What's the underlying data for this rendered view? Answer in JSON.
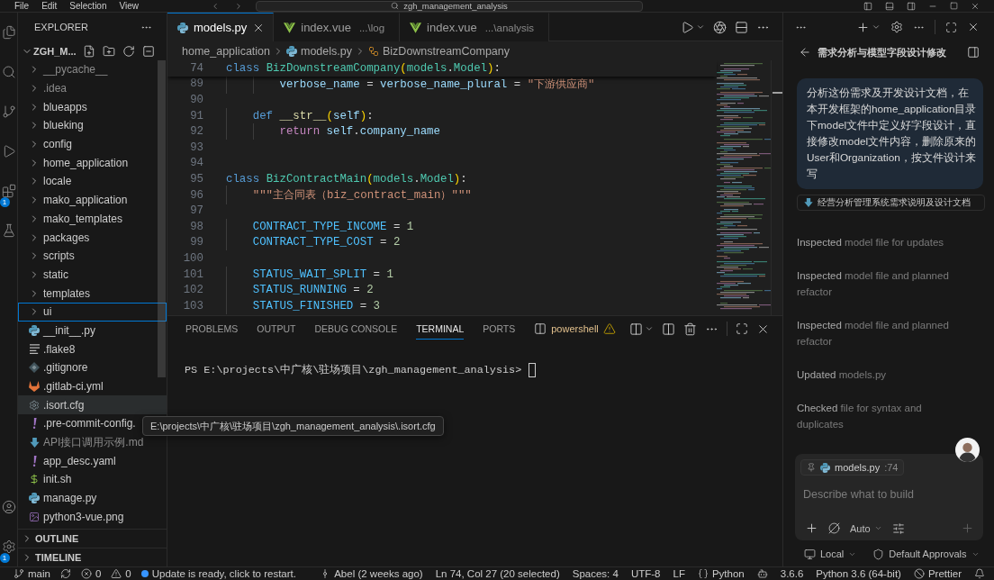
{
  "title_bar": {
    "menu": [
      "File",
      "Edit",
      "Selection",
      "View"
    ],
    "command_center": "zgh_management_analysis"
  },
  "activity_bar": {
    "items": [
      {
        "kind": "files"
      },
      {
        "kind": "search"
      },
      {
        "kind": "source_control"
      },
      {
        "kind": "run"
      },
      {
        "kind": "extensions",
        "badge": "1"
      },
      {
        "kind": "testing"
      }
    ],
    "bottom": [
      {
        "kind": "account"
      },
      {
        "kind": "settings",
        "badge": "1"
      }
    ]
  },
  "explorer": {
    "title": "EXPLORER",
    "root": {
      "label": "ZGH_M...",
      "expanded": true
    },
    "items": [
      {
        "name": "__pycache__",
        "kind": "folder",
        "expanded": false,
        "dimmed": true,
        "selected": false,
        "hovered": false
      },
      {
        "name": ".idea",
        "kind": "folder",
        "expanded": false,
        "dimmed": true,
        "selected": false,
        "hovered": false
      },
      {
        "name": "blueapps",
        "kind": "folder",
        "expanded": false,
        "dimmed": false,
        "selected": false,
        "hovered": false
      },
      {
        "name": "blueking",
        "kind": "folder",
        "expanded": false,
        "dimmed": false,
        "selected": false,
        "hovered": false
      },
      {
        "name": "config",
        "kind": "folder",
        "expanded": false,
        "dimmed": false,
        "selected": false,
        "hovered": false
      },
      {
        "name": "home_application",
        "kind": "folder",
        "expanded": false,
        "dimmed": false,
        "selected": false,
        "hovered": false
      },
      {
        "name": "locale",
        "kind": "folder",
        "expanded": false,
        "dimmed": false,
        "selected": false,
        "hovered": false
      },
      {
        "name": "mako_application",
        "kind": "folder",
        "expanded": false,
        "dimmed": false,
        "selected": false,
        "hovered": false
      },
      {
        "name": "mako_templates",
        "kind": "folder",
        "expanded": false,
        "dimmed": false,
        "selected": false,
        "hovered": false
      },
      {
        "name": "packages",
        "kind": "folder",
        "expanded": false,
        "dimmed": false,
        "selected": false,
        "hovered": false
      },
      {
        "name": "scripts",
        "kind": "folder",
        "expanded": false,
        "dimmed": false,
        "selected": false,
        "hovered": false
      },
      {
        "name": "static",
        "kind": "folder",
        "expanded": false,
        "dimmed": false,
        "selected": false,
        "hovered": false
      },
      {
        "name": "templates",
        "kind": "folder",
        "expanded": false,
        "dimmed": false,
        "selected": false,
        "hovered": false
      },
      {
        "name": "ui",
        "kind": "folder",
        "expanded": false,
        "dimmed": false,
        "selected": true,
        "hovered": false
      },
      {
        "name": "__init__.py",
        "kind": "python",
        "dimmed": false,
        "selected": false,
        "hovered": false
      },
      {
        "name": ".flake8",
        "kind": "lines",
        "dimmed": false,
        "selected": false,
        "hovered": false
      },
      {
        "name": ".gitignore",
        "kind": "git",
        "dimmed": false,
        "selected": false,
        "hovered": false
      },
      {
        "name": ".gitlab-ci.yml",
        "kind": "gitlab",
        "dimmed": false,
        "selected": false,
        "hovered": false
      },
      {
        "name": ".isort.cfg",
        "kind": "gear",
        "dimmed": false,
        "selected": false,
        "hovered": true
      },
      {
        "name": ".pre-commit-config.",
        "kind": "yaml",
        "dimmed": false,
        "selected": false,
        "hovered": false
      },
      {
        "name": "API接口调用示例.md",
        "kind": "markdown",
        "dimmed": true,
        "selected": false,
        "hovered": false
      },
      {
        "name": "app_desc.yaml",
        "kind": "yaml",
        "dimmed": false,
        "selected": false,
        "hovered": false
      },
      {
        "name": "init.sh",
        "kind": "shell",
        "dimmed": false,
        "selected": false,
        "hovered": false
      },
      {
        "name": "manage.py",
        "kind": "python",
        "dimmed": false,
        "selected": false,
        "hovered": false
      },
      {
        "name": "python3-vue.png",
        "kind": "image",
        "dimmed": false,
        "selected": false,
        "hovered": false
      }
    ],
    "sections": [
      {
        "title": "OUTLINE",
        "expanded": false
      },
      {
        "title": "TIMELINE",
        "expanded": false
      }
    ],
    "tooltip": "E:\\projects\\中广核\\驻场项目\\zgh_management_analysis\\.isort.cfg"
  },
  "editor": {
    "tabs": [
      {
        "label": "models.py",
        "kind": "python",
        "selected": true
      },
      {
        "label": "index.vue",
        "description": "...\\log",
        "kind": "vue",
        "selected": false
      },
      {
        "label": "index.vue",
        "description": "...\\analysis",
        "kind": "vue",
        "selected": false
      }
    ],
    "breadcrumb": [
      {
        "label": "home_application",
        "kind": "folder"
      },
      {
        "label": "models.py",
        "kind": "python"
      },
      {
        "label": "BizDownstreamCompany",
        "kind": "class"
      }
    ],
    "sticky_lines": [
      {
        "number": "74",
        "tokens": [
          {
            "text": "class ",
            "kind": "keyword"
          },
          {
            "text": "BizDownstreamCompany",
            "kind": "type"
          },
          {
            "text": "(",
            "kind": "bracket"
          },
          {
            "text": "models",
            "kind": "type"
          },
          {
            "text": ".",
            "kind": "plain"
          },
          {
            "text": "Model",
            "kind": "type"
          },
          {
            "text": ")",
            "kind": "bracket"
          },
          {
            "text": ":",
            "kind": "plain"
          }
        ]
      }
    ],
    "lines": [
      {
        "number": "89",
        "tokens": [
          {
            "text": "        verbose_name",
            "kind": "variable"
          },
          {
            "text": " = ",
            "kind": "plain"
          },
          {
            "text": "verbose_name_plural",
            "kind": "variable"
          },
          {
            "text": " = ",
            "kind": "plain"
          },
          {
            "text": "\"下游供应商\"",
            "kind": "string"
          }
        ]
      },
      {
        "number": "90"
      },
      {
        "number": "91",
        "tokens": [
          {
            "text": "    def ",
            "kind": "keyword"
          },
          {
            "text": "__str__",
            "kind": "function"
          },
          {
            "text": "(",
            "kind": "bracket"
          },
          {
            "text": "self",
            "kind": "variable"
          },
          {
            "text": ")",
            "kind": "bracket"
          },
          {
            "text": ":",
            "kind": "plain"
          }
        ]
      },
      {
        "number": "92",
        "tokens": [
          {
            "text": "        return ",
            "kind": "control"
          },
          {
            "text": "self",
            "kind": "variable"
          },
          {
            "text": ".",
            "kind": "plain"
          },
          {
            "text": "company_name",
            "kind": "variable"
          }
        ]
      },
      {
        "number": "93"
      },
      {
        "number": "94"
      },
      {
        "number": "95",
        "tokens": [
          {
            "text": "class ",
            "kind": "keyword"
          },
          {
            "text": "BizContractMain",
            "kind": "type"
          },
          {
            "text": "(",
            "kind": "bracket"
          },
          {
            "text": "models",
            "kind": "type"
          },
          {
            "text": ".",
            "kind": "plain"
          },
          {
            "text": "Model",
            "kind": "type"
          },
          {
            "text": ")",
            "kind": "bracket"
          },
          {
            "text": ":",
            "kind": "plain"
          }
        ]
      },
      {
        "number": "96",
        "tokens": [
          {
            "text": "    \"\"\"主合同表（biz_contract_main）\"\"\"",
            "kind": "string"
          }
        ]
      },
      {
        "number": "97"
      },
      {
        "number": "98",
        "tokens": [
          {
            "text": "    CONTRACT_TYPE_INCOME",
            "kind": "constant"
          },
          {
            "text": " = ",
            "kind": "plain"
          },
          {
            "text": "1",
            "kind": "number"
          }
        ]
      },
      {
        "number": "99",
        "tokens": [
          {
            "text": "    CONTRACT_TYPE_COST",
            "kind": "constant"
          },
          {
            "text": " = ",
            "kind": "plain"
          },
          {
            "text": "2",
            "kind": "number"
          }
        ]
      },
      {
        "number": "100"
      },
      {
        "number": "101",
        "tokens": [
          {
            "text": "    STATUS_WAIT_SPLIT",
            "kind": "constant"
          },
          {
            "text": " = ",
            "kind": "plain"
          },
          {
            "text": "1",
            "kind": "number"
          }
        ]
      },
      {
        "number": "102",
        "tokens": [
          {
            "text": "    STATUS_RUNNING",
            "kind": "constant"
          },
          {
            "text": " = ",
            "kind": "plain"
          },
          {
            "text": "2",
            "kind": "number"
          }
        ]
      },
      {
        "number": "103",
        "tokens": [
          {
            "text": "    STATUS_FINISHED",
            "kind": "constant"
          },
          {
            "text": " = ",
            "kind": "plain"
          },
          {
            "text": "3",
            "kind": "number"
          }
        ]
      }
    ]
  },
  "panel": {
    "tabs": [
      {
        "label": "PROBLEMS",
        "selected": false
      },
      {
        "label": "OUTPUT",
        "selected": false
      },
      {
        "label": "DEBUG CONSOLE",
        "selected": false
      },
      {
        "label": "TERMINAL",
        "selected": true
      },
      {
        "label": "PORTS",
        "selected": false
      }
    ],
    "terminal": {
      "profile": "powershell",
      "warning": true,
      "prompt": "PS E:\\projects\\中广核\\驻场项目\\zgh_management_analysis>"
    }
  },
  "chat": {
    "title": "需求分析与模型字段设计修改",
    "message": "分析这份需求及开发设计文档，在本开发框架的home_application目录下model文件中定义好字段设计，直接修改model文件内容，删除原来的User和Organization，按文件设计来写",
    "attachment": "经营分析管理系统需求说明及设计文档",
    "steps": [
      {
        "verb": "Inspected",
        "detail": "model file for updates"
      },
      {
        "verb": "Inspected",
        "detail": "model file and planned refactor"
      },
      {
        "verb": "Inspected",
        "detail": "model file and planned refactor"
      },
      {
        "verb": "Updated",
        "detail": "models.py"
      },
      {
        "verb": "Checked",
        "detail": "file for syntax and duplicates"
      }
    ],
    "composer": {
      "context": {
        "file": "models.py",
        "position": ":74"
      },
      "placeholder": "Describe what to build",
      "mode": "Auto"
    },
    "footer": [
      {
        "kind": "local",
        "label": "Local"
      },
      {
        "kind": "approvals",
        "label": "Default Approvals"
      }
    ]
  },
  "status_bar": {
    "left": [
      {
        "kind": "branch",
        "label": "main"
      },
      {
        "kind": "sync"
      },
      {
        "kind": "errors",
        "label": "0"
      },
      {
        "kind": "warnings",
        "label": "0"
      },
      {
        "kind": "update",
        "label": "Update is ready, click to restart."
      }
    ],
    "right": [
      {
        "kind": "blame",
        "label": "Abel (2 weeks ago)"
      },
      {
        "kind": "text",
        "label": "Ln 74, Col 27 (20 selected)"
      },
      {
        "kind": "text",
        "label": "Spaces: 4"
      },
      {
        "kind": "text",
        "label": "UTF-8"
      },
      {
        "kind": "text",
        "label": "LF"
      },
      {
        "kind": "language",
        "label": "Python"
      },
      {
        "kind": "copilot"
      },
      {
        "kind": "text",
        "label": "3.6.6"
      },
      {
        "kind": "text",
        "label": "Python 3.6 (64-bit)"
      },
      {
        "kind": "prettier",
        "label": "Prettier"
      },
      {
        "kind": "bell"
      }
    ]
  }
}
